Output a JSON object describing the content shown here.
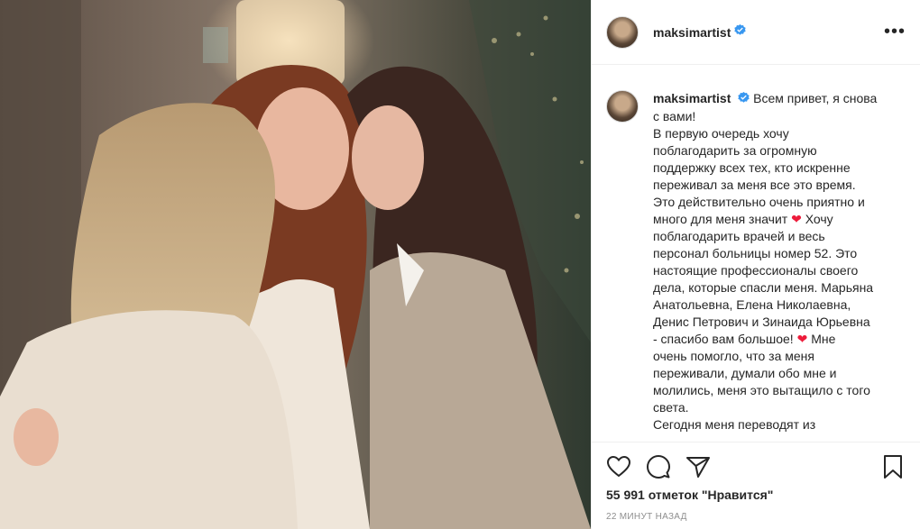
{
  "post": {
    "username": "maksimartist",
    "verified": true,
    "more_icon": "more-horizontal-icon",
    "caption_lines": [
      "Всем привет, я снова",
      "с вами!",
      "В первую очередь хочу",
      "поблагодарить за огромную",
      "поддержку всех тех, кто искренне",
      "переживал за меня все это время.",
      "Это действительно очень приятно и",
      "много для меня значит",
      "поблагодарить врачей и весь",
      "персонал больницы номер 52. Это",
      "настоящие профессионалы своего",
      "дела, которые спасли меня. Марьяна",
      "Анатольевна, Елена Николаевна,",
      "Денис Петрович и Зинаида Юрьевна",
      "- спасибо вам большое!",
      "очень помогло, что за меня",
      "переживали, думали обо мне и",
      "молились, меня это вытащило с того",
      "света.",
      "Сегодня меня переводят из"
    ],
    "caption_tail_1": "Хочу",
    "caption_tail_2": "Мне",
    "likes": "55 991 отметок \"Нравится\"",
    "timestamp": "22 МИНУТ НАЗАД",
    "icons": [
      "heart-icon",
      "comment-icon",
      "share-icon",
      "bookmark-icon"
    ],
    "colors": {
      "verified": "#3897f0",
      "heart": "#ed1c3b"
    }
  }
}
